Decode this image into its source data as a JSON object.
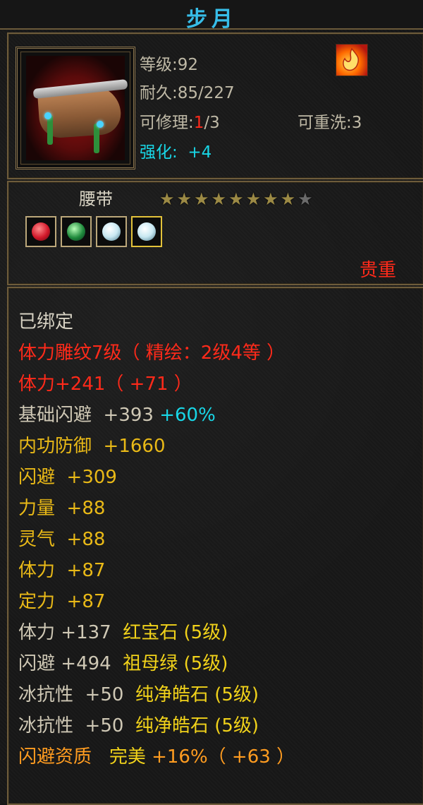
{
  "header": {
    "title": "步月"
  },
  "item": {
    "level_text": "等级:92",
    "durability_text": "耐久:85/227",
    "repair_prefix": "可修理:",
    "repair_current": "1",
    "repair_suffix": "/3",
    "rewash_text": "可重洗:3",
    "enhance_label": "强化:",
    "enhance_value": "+4",
    "type_name": "腰带",
    "rarity": "贵重",
    "stars": {
      "filled": 8,
      "total": 9
    }
  },
  "gems": [
    {
      "name": "ruby-gem",
      "color": "#d2182a"
    },
    {
      "name": "emerald-gem",
      "color": "#1f8a3c"
    },
    {
      "name": "diamond-gem",
      "color": "#c8e8f2"
    },
    {
      "name": "diamond-gem",
      "color": "#c8e8f2"
    }
  ],
  "attributes": {
    "bound": "已绑定",
    "engrave": "体力雕纹7级（ 精绘：2级4等 ）",
    "stamina_main": "体力+241（ +71 ）",
    "dodge_base_label": "基础闪避",
    "dodge_base_value": "+393",
    "dodge_base_bonus": "+60%",
    "inner_def_label": "内功防御",
    "inner_def_value": "+1660",
    "dodge_label": "闪避",
    "dodge_value": "+309",
    "strength_label": "力量",
    "strength_value": "+88",
    "spirit_label": "灵气",
    "spirit_value": "+88",
    "stamina_label": "体力",
    "stamina_value": "+87",
    "focus_label": "定力",
    "focus_value": "+87",
    "gem_stamina_label": "体力",
    "gem_stamina_value": "+137",
    "gem_stamina_name": "红宝石",
    "gem_stamina_level": "(5级)",
    "gem_dodge_label": "闪避",
    "gem_dodge_value": "+494",
    "gem_dodge_name": "祖母绿",
    "gem_dodge_level": "(5级)",
    "gem_ice1_label": "冰抗性",
    "gem_ice1_value": "+50",
    "gem_ice1_name": "纯净皓石",
    "gem_ice1_level": "(5级)",
    "gem_ice2_label": "冰抗性",
    "gem_ice2_value": "+50",
    "gem_ice2_name": "纯净皓石",
    "gem_ice2_level": "(5级)",
    "quality_label": "闪避资质",
    "quality_grade": "完美",
    "quality_value": "+16%（ +63 ）"
  }
}
